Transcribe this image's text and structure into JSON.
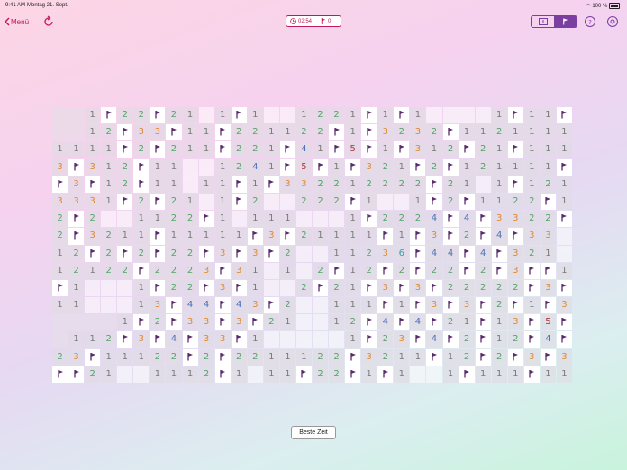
{
  "status_bar": {
    "time": "9:41 AM",
    "date": "Montag 21. Sept.",
    "battery": "100 %"
  },
  "nav": {
    "back_label": "Menü",
    "timer": "02:54",
    "flag_count": "0"
  },
  "colors": {
    "accent": "#c2185b",
    "mode_active": "#7b3ea1"
  },
  "best_time_label": "Beste Zeit",
  "board": {
    "rows": [
      "__1F22F21_1F1__1221F1F1____1F11F",
      "__12F33F11F221122F1F3232F1121111F",
      "1111F2F211F221F41F5F1F312F21F1111",
      "3F312F11__1241F5F1F321F2F121111F1",
      "F3F12F11_11F1F332212222F21_1F1211",
      "3331F2F21_1F2__222F1__1F2F1122F11",
      "2F2__1122F1_111___1F2224F4F3322F1",
      "2F3211F11111F3F21111F1F3F2F4F33__",
      "12F2F2F22F3F3F2__11236F44F4F321__",
      "12122F2223F31_1_2F12F2F22F2F3FF1_",
      "F1___1F22F3F1__2F21F3F3F22222F3F1",
      "11___13F44F43F2__111F1F3F3F2F1F3F1",
      "____1F2F33F3F21__12F4F4F21F13F5F3",
      "_112F3F4F33F1_____1F23F4F2F12F4FF",
      "23F11122F2F2211122F3211F12F2F3F3F",
      "FF21__1112F1_11F22F1F1__1F111F111"
    ],
    "opened_blanks": [
      "11000000000000000000000000000000",
      "1100000000000000000000000000000",
      "",
      "",
      "",
      "",
      "",
      "",
      "",
      "",
      "",
      "",
      "1111",
      "1",
      "",
      ""
    ]
  }
}
